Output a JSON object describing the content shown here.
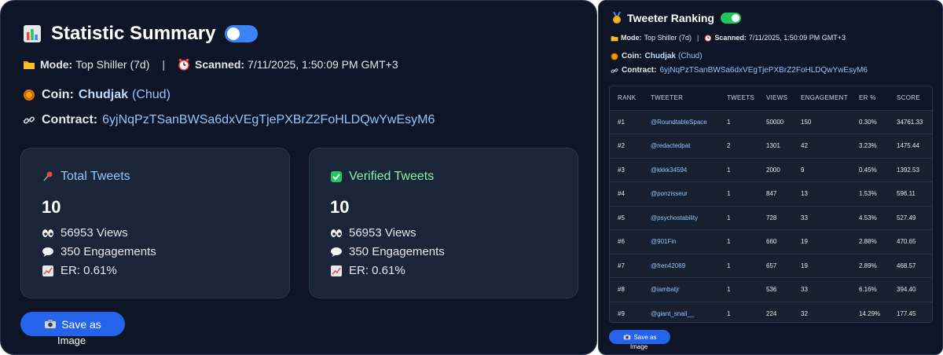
{
  "summary": {
    "title": "Statistic Summary",
    "mode_label": "Mode:",
    "mode_value": "Top Shiller (7d)",
    "separator": "|",
    "scanned_label": "Scanned:",
    "scanned_value": "7/11/2025, 1:50:09 PM GMT+3",
    "coin_label": "Coin:",
    "coin_name": "Chudjak",
    "coin_ticker": "(Chud)",
    "contract_label": "Contract:",
    "contract_value": "6yjNqPzTSanBWSa6dxVEgTjePXBrZ2FoHLDQwYwEsyM6",
    "cards": [
      {
        "title": "Total Tweets",
        "count": "10",
        "views": "56953 Views",
        "engagements": "350 Engagements",
        "er": "ER: 0.61%"
      },
      {
        "title": "Verified Tweets",
        "count": "10",
        "views": "56953 Views",
        "engagements": "350 Engagements",
        "er": "ER: 0.61%"
      }
    ],
    "save_label": "Save as",
    "save_label_2": "Image",
    "toggle_on": true
  },
  "ranking": {
    "title": "Tweeter Ranking",
    "mode_label": "Mode:",
    "mode_value": "Top Shiller (7d)",
    "separator": "|",
    "scanned_label": "Scanned:",
    "scanned_value": "7/11/2025, 1:50:09 PM GMT+3",
    "coin_label": "Coin:",
    "coin_name": "Chudjak",
    "coin_ticker": "(Chud)",
    "contract_label": "Contract:",
    "contract_value": "6yjNqPzTSanBWSa6dxVEgTjePXBrZ2FoHLDQwYwEsyM6",
    "columns": [
      "RANK",
      "TWEETER",
      "TWEETS",
      "VIEWS",
      "ENGAGEMENT",
      "ER %",
      "SCORE"
    ],
    "rows": [
      {
        "rank": "#1",
        "tweeter": "@RoundtableSpace",
        "tweets": "1",
        "views": "50000",
        "engagement": "150",
        "er": "0.30%",
        "score": "34761.33"
      },
      {
        "rank": "#2",
        "tweeter": "@redactedpat",
        "tweets": "2",
        "views": "1301",
        "engagement": "42",
        "er": "3.23%",
        "score": "1475.44"
      },
      {
        "rank": "#3",
        "tweeter": "@kkkk34594",
        "tweets": "1",
        "views": "2000",
        "engagement": "9",
        "er": "0.45%",
        "score": "1392.53"
      },
      {
        "rank": "#4",
        "tweeter": "@ponzisseur",
        "tweets": "1",
        "views": "847",
        "engagement": "13",
        "er": "1.53%",
        "score": "596.11"
      },
      {
        "rank": "#5",
        "tweeter": "@psychostability",
        "tweets": "1",
        "views": "728",
        "engagement": "33",
        "er": "4.53%",
        "score": "527.49"
      },
      {
        "rank": "#6",
        "tweeter": "@901Fin",
        "tweets": "1",
        "views": "660",
        "engagement": "19",
        "er": "2.88%",
        "score": "470.65"
      },
      {
        "rank": "#7",
        "tweeter": "@fren42069",
        "tweets": "1",
        "views": "657",
        "engagement": "19",
        "er": "2.89%",
        "score": "468.57"
      },
      {
        "rank": "#8",
        "tweeter": "@iambatjr",
        "tweets": "1",
        "views": "536",
        "engagement": "33",
        "er": "6.16%",
        "score": "394.40"
      },
      {
        "rank": "#9",
        "tweeter": "@giant_snail__",
        "tweets": "1",
        "views": "224",
        "engagement": "32",
        "er": "14.29%",
        "score": "177.45"
      }
    ],
    "save_label": "Save as",
    "save_label_2": "Image",
    "toggle_on": true
  },
  "icons": {
    "chart": "bar-chart-icon",
    "mode": "folder-icon",
    "scanned": "alarm-clock-icon",
    "coin": "coin-icon",
    "contract": "link-icon",
    "total": "pushpin-icon",
    "verified": "check-mark-icon",
    "views": "eyes-icon",
    "engagements": "speech-bubble-icon",
    "er": "trend-up-icon",
    "camera": "camera-icon",
    "medal": "medal-icon"
  },
  "colors": {
    "background": "#0d1526",
    "card": "#1b2538",
    "accent_blue": "#2563eb",
    "toggle_blue": "#3b82f6",
    "toggle_green": "#22c55e",
    "link_blue": "#93c5fd",
    "verified_green": "#86efac"
  }
}
